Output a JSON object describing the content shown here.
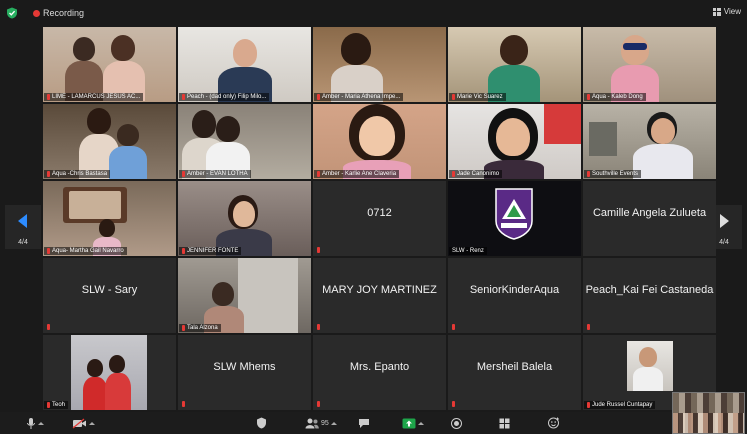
{
  "header": {
    "recording_label": "Recording",
    "view_label": "View",
    "colors": {
      "shield": "#27ae60",
      "recording": "#e53935",
      "nav_accent": "#2d8cff"
    }
  },
  "tiles": [
    {
      "caption": "LIME - LAMARCUS JESUS AC...",
      "type": "video"
    },
    {
      "caption": "Peach - (dad only) Filip Milo...",
      "type": "video"
    },
    {
      "caption": "Amber - Maria Athena Impe...",
      "type": "video"
    },
    {
      "caption": "Marie Vic Suarez",
      "type": "video"
    },
    {
      "caption": "Aqua - Kaleb Dong",
      "type": "video"
    },
    {
      "caption": "Aqua -Chris Bastasa",
      "type": "video"
    },
    {
      "caption": "Amber - EVAN LOTHA",
      "type": "video"
    },
    {
      "caption": "Amber - Karlie Ane Claveria",
      "type": "video"
    },
    {
      "caption": "Jade Canonimo",
      "type": "video"
    },
    {
      "caption": "Southville Events",
      "type": "video"
    },
    {
      "caption": "Aqua- Martha Gail Navarro",
      "type": "video"
    },
    {
      "caption": "JENNIFER FONTE",
      "type": "video"
    },
    {
      "name": "0712",
      "type": "name"
    },
    {
      "caption": "SLW - Renz",
      "type": "video"
    },
    {
      "name": "Camille Angela Zulueta",
      "type": "name"
    },
    {
      "name": "SLW - Sary",
      "type": "name"
    },
    {
      "caption": "Tala Alzona",
      "type": "video"
    },
    {
      "name": "MARY JOY MARTINEZ",
      "type": "name"
    },
    {
      "name": "SeniorKinderAqua",
      "type": "name"
    },
    {
      "name": "Peach_Kai Fei Castaneda",
      "type": "name"
    },
    {
      "caption": "Teoh",
      "type": "video"
    },
    {
      "name": "SLW Mhems",
      "type": "name"
    },
    {
      "name": "Mrs. Epanto",
      "type": "name"
    },
    {
      "name": "Mersheil Balela",
      "type": "name"
    },
    {
      "caption": "Jude Russel Cuntapay",
      "type": "video"
    }
  ],
  "pager": {
    "left_label": "4/4",
    "right_label": "4/4"
  },
  "toolbar": {
    "participants_count": "95"
  }
}
